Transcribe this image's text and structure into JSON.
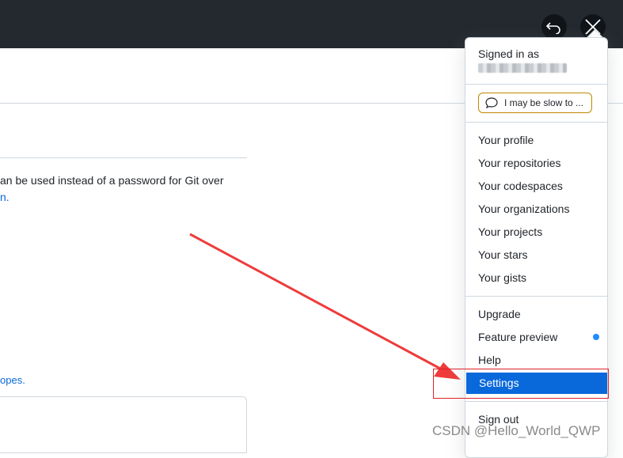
{
  "main": {
    "body_line1": "an be used instead of a password for Git over",
    "body_line2_link": "n.",
    "scopes_link": "opes."
  },
  "dropdown": {
    "signed_in_label": "Signed in as",
    "status_label": "I may be slow to ...",
    "items_group1": [
      "Your profile",
      "Your repositories",
      "Your codespaces",
      "Your organizations",
      "Your projects",
      "Your stars",
      "Your gists"
    ],
    "items_group2": [
      "Upgrade",
      "Feature preview",
      "Help",
      "Settings"
    ],
    "sign_out": "Sign out",
    "active_item": "Settings"
  },
  "watermark": "CSDN @Hello_World_QWP",
  "colors": {
    "topbar": "#24292f",
    "accent": "#0969da",
    "annotation": "#e0202a"
  }
}
